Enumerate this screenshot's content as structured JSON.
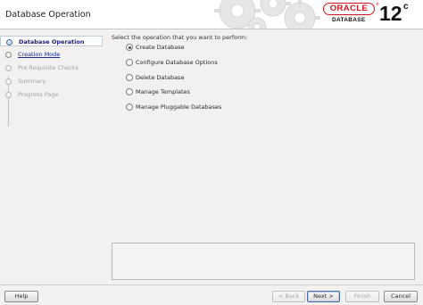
{
  "header": {
    "title": "Database Operation",
    "logo": {
      "brand": "ORACLE",
      "registered": "®",
      "product": "DATABASE",
      "version": "12",
      "version_suffix": "c",
      "brand_color": "#d0161e"
    }
  },
  "steps": [
    {
      "label": "Database Operation",
      "state": "current"
    },
    {
      "label": "Creation Mode",
      "state": "next"
    },
    {
      "label": "Pre Requisite Checks",
      "state": "disabled"
    },
    {
      "label": "Summary",
      "state": "disabled"
    },
    {
      "label": "Progress Page",
      "state": "disabled"
    }
  ],
  "main": {
    "prompt": "Select the operation that you want to perform:",
    "options": [
      {
        "label": "Create Database",
        "selected": true
      },
      {
        "label": "Configure Database Options",
        "selected": false
      },
      {
        "label": "Delete Database",
        "selected": false
      },
      {
        "label": "Manage Templates",
        "selected": false
      },
      {
        "label": "Manage Pluggable Databases",
        "selected": false
      }
    ]
  },
  "footer": {
    "help": "Help",
    "back": "< Back",
    "next": "Next >",
    "finish": "Finish",
    "cancel": "Cancel"
  }
}
